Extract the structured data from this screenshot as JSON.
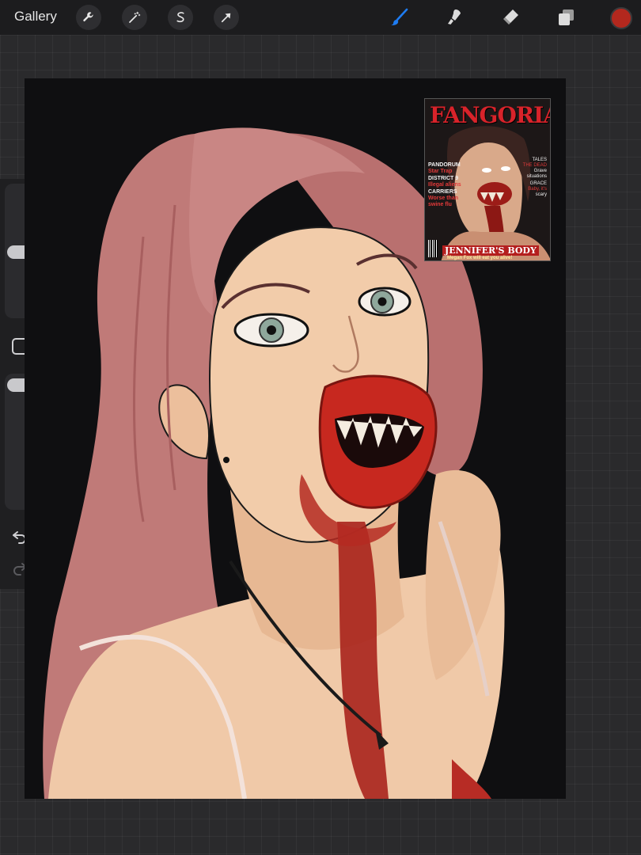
{
  "toolbar": {
    "gallery_label": "Gallery",
    "left_tools": [
      "wrench-icon",
      "magic-wand-icon",
      "selection-s-icon",
      "transform-arrow-icon"
    ],
    "right_tools": [
      "brush-icon",
      "smudge-icon",
      "eraser-icon",
      "layers-icon"
    ],
    "active_tool": "brush-icon",
    "active_color": "#b3281e",
    "accent_color": "#1e7cf2"
  },
  "sidebar": {
    "brush_size_level": 0.27,
    "opacity_level": 0.06,
    "controls": [
      "brush-size-slider",
      "modifier-button",
      "opacity-slider",
      "undo-icon",
      "redo-icon"
    ]
  },
  "reference": {
    "title": "FANGORIA",
    "cover_lines": [
      "PANDORUM",
      "Star Trap",
      "DISTRICT 9",
      "Illegal aliens",
      "CARRIERS",
      "Worse than",
      "swine flu"
    ],
    "right_lines": [
      "TALES",
      "THE DEAD",
      "Grave",
      "situations",
      "GRACE",
      "Baby, it's",
      "scary"
    ],
    "banner": "JENNIFER'S BODY",
    "subline": "Megan Fox will eat you alive!"
  }
}
